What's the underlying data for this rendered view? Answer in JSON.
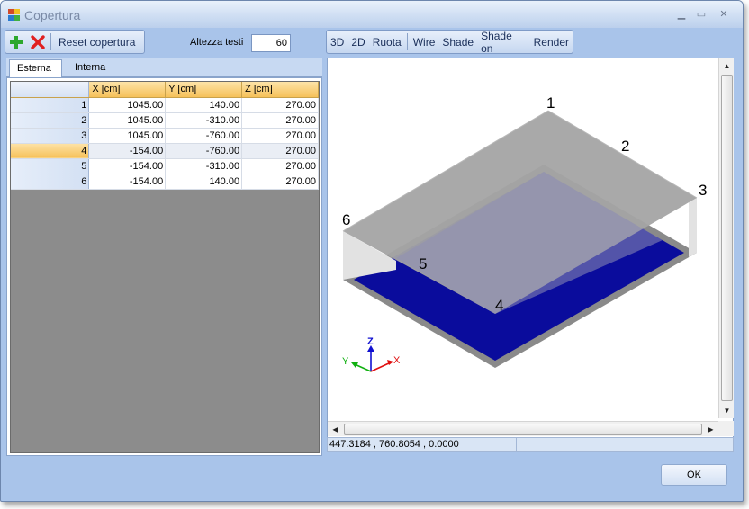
{
  "window": {
    "title": "Copertura",
    "minimize": "▁",
    "maximize": "▭",
    "close": "✕"
  },
  "toolbar_left": {
    "add_icon": "plus-icon",
    "delete_icon": "red-x-icon",
    "reset_label": "Reset copertura",
    "altezza_label": "Altezza testi",
    "altezza_value": "60"
  },
  "toolbar_right": {
    "buttons": [
      "3D",
      "2D",
      "Ruota",
      "Wire",
      "Shade",
      "Shade on",
      "Render"
    ]
  },
  "tabs": [
    "Esterna",
    "Interna"
  ],
  "grid": {
    "columns": [
      "X [cm]",
      "Y [cm]",
      "Z [cm]"
    ],
    "rows": [
      {
        "n": "1",
        "x": "1045.00",
        "y": "140.00",
        "z": "270.00"
      },
      {
        "n": "2",
        "x": "1045.00",
        "y": "-310.00",
        "z": "270.00"
      },
      {
        "n": "3",
        "x": "1045.00",
        "y": "-760.00",
        "z": "270.00"
      },
      {
        "n": "4",
        "x": "-154.00",
        "y": "-760.00",
        "z": "270.00"
      },
      {
        "n": "5",
        "x": "-154.00",
        "y": "-310.00",
        "z": "270.00"
      },
      {
        "n": "6",
        "x": "-154.00",
        "y": "140.00",
        "z": "270.00"
      }
    ],
    "selected_row": "4"
  },
  "viewport": {
    "vertex_labels": [
      "1",
      "2",
      "3",
      "4",
      "5",
      "6"
    ],
    "axes": {
      "x": "X",
      "y": "Y",
      "z": "Z"
    },
    "colors": {
      "roof": "#a4a4a4",
      "floor": "#0a0c9c",
      "wall": "#e2e2e2",
      "axis_x": "#e01010",
      "axis_y": "#10b010",
      "axis_z": "#1010d0"
    }
  },
  "status": {
    "coords": "447.3184 , 760.8054 , 0.0000"
  },
  "ok_label": "OK"
}
